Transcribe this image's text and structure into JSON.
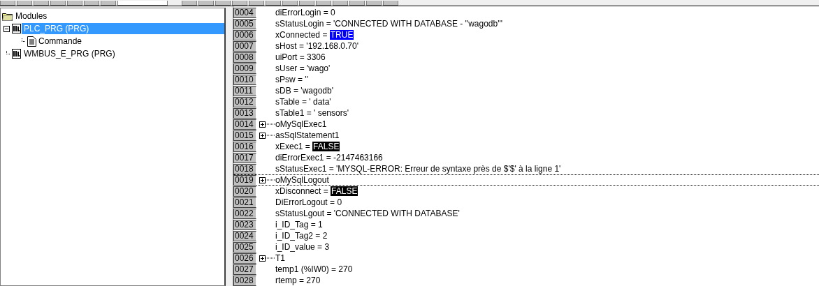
{
  "toolbar": {
    "buttons": [
      {
        "kind": "button"
      },
      {
        "kind": "button"
      },
      {
        "kind": "button"
      },
      {
        "kind": "button"
      },
      {
        "kind": "button"
      },
      {
        "kind": "button"
      },
      {
        "kind": "button"
      },
      {
        "kind": "field"
      },
      {
        "kind": "button"
      },
      {
        "kind": "button"
      },
      {
        "kind": "button"
      },
      {
        "kind": "button"
      },
      {
        "kind": "button"
      },
      {
        "kind": "button"
      },
      {
        "kind": "button"
      },
      {
        "kind": "button"
      },
      {
        "kind": "button"
      },
      {
        "kind": "button"
      },
      {
        "kind": "button"
      },
      {
        "kind": "button"
      },
      {
        "kind": "button"
      }
    ]
  },
  "tree": {
    "label": "Modules",
    "children": [
      {
        "label": "PLC_PRG (PRG)",
        "kind": "program",
        "selected": true,
        "expanded": true,
        "children": [
          {
            "label": "Commande",
            "kind": "action",
            "selected": false
          }
        ]
      },
      {
        "label": "WMBUS_E_PRG (PRG)",
        "kind": "program",
        "selected": false
      }
    ]
  },
  "lines": [
    {
      "number": "0004",
      "kind": "plain",
      "text": "diErrorLogin = 0",
      "selected": false
    },
    {
      "number": "0005",
      "kind": "plain",
      "text": "sStatusLogin = 'CONNECTED WITH DATABASE - ''wagodb'''",
      "selected": false
    },
    {
      "number": "0006",
      "kind": "plain",
      "text": "xConnected = ",
      "value": "TRUE",
      "color": "#0000ff",
      "selected": false
    },
    {
      "number": "0007",
      "kind": "plain",
      "text": "sHost = '192.168.0.70'",
      "selected": false
    },
    {
      "number": "0008",
      "kind": "plain",
      "text": "uiPort = 3306",
      "selected": false
    },
    {
      "number": "0009",
      "kind": "plain",
      "text": "sUser = 'wago'",
      "selected": false
    },
    {
      "number": "0010",
      "kind": "plain",
      "text": "sPsw = ''",
      "selected": false
    },
    {
      "number": "0011",
      "kind": "plain",
      "text": "sDB = 'wagodb'",
      "selected": false
    },
    {
      "number": "0012",
      "kind": "plain",
      "text": "sTable = ' data'",
      "selected": false
    },
    {
      "number": "0013",
      "kind": "plain",
      "text": "sTable1 = ' sensors'",
      "selected": false
    },
    {
      "number": "0014",
      "kind": "struct",
      "text": "oMySqlExec1",
      "expanded": false,
      "selected": false
    },
    {
      "number": "0015",
      "kind": "struct",
      "text": "asSqlStatement1",
      "expanded": false,
      "selected": false
    },
    {
      "number": "0016",
      "kind": "plain",
      "text": "xExec1 = ",
      "value": "FALSE",
      "color": "#000000",
      "selected": false
    },
    {
      "number": "0017",
      "kind": "plain",
      "text": "diErrorExec1 = -2147463166",
      "selected": false
    },
    {
      "number": "0018",
      "kind": "plain",
      "text": "sStatusExec1 = 'MYSQL-ERROR: Erreur de syntaxe près de $'$' à la ligne 1'",
      "selected": false
    },
    {
      "number": "0019",
      "kind": "struct",
      "text": "oMySqlLogout",
      "expanded": false,
      "selected": true
    },
    {
      "number": "0020",
      "kind": "plain",
      "text": "xDisconnect = ",
      "value": "FALSE",
      "color": "#000000",
      "selected": false
    },
    {
      "number": "0021",
      "kind": "plain",
      "text": "DiErrorLogout = 0",
      "selected": false
    },
    {
      "number": "0022",
      "kind": "plain",
      "text": "sStatusLgout = 'CONNECTED WITH DATABASE'",
      "selected": false
    },
    {
      "number": "0023",
      "kind": "plain",
      "text": "i_ID_Tag = 1",
      "selected": false
    },
    {
      "number": "0024",
      "kind": "plain",
      "text": "i_ID_Tag2 = 2",
      "selected": false
    },
    {
      "number": "0025",
      "kind": "plain",
      "text": "i_ID_value = 3",
      "selected": false
    },
    {
      "number": "0026",
      "kind": "struct",
      "text": "T1",
      "expanded": false,
      "selected": false
    },
    {
      "number": "0027",
      "kind": "plain",
      "text": "temp1 (%IW0) = 270",
      "selected": false
    },
    {
      "number": "0028",
      "kind": "plain",
      "text": "rtemp = 270",
      "selected": false
    }
  ]
}
